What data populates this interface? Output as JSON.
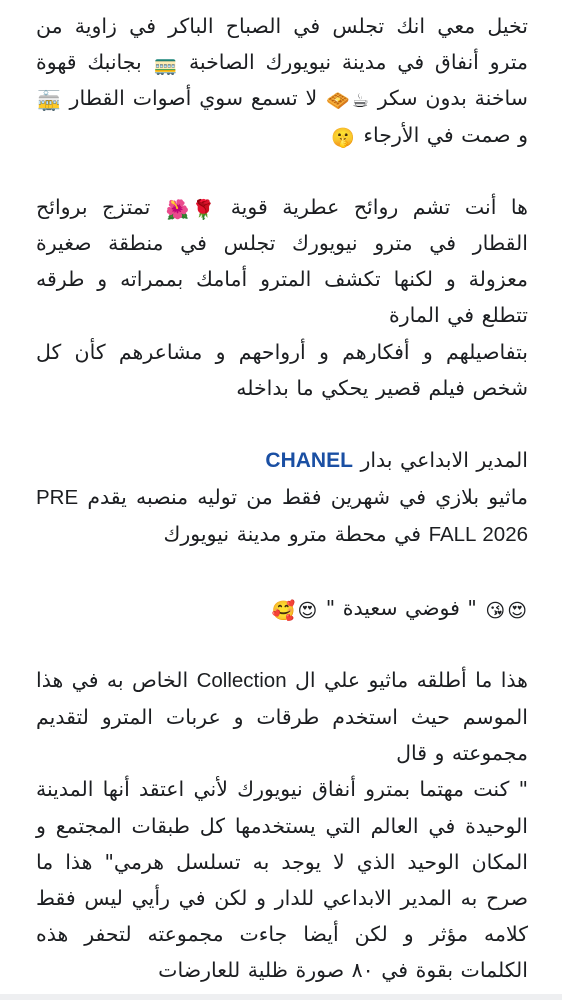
{
  "post": {
    "p1": {
      "a": "تخيل معي انك تجلس في الصباح الباكر في زاوية من مترو أنفاق في مدينة نيويورك الصاخبة",
      "train_emoji": "🚃",
      "b": "بجانبك قهوة ساخنة بدون سكر",
      "coffee_emoji": "☕",
      "waffle_emoji": "🧇",
      "c": "لا تسمع سوي أصوات القطار",
      "tram_emoji": "🚋",
      "d": "و صمت في الأرجاء",
      "shush_emoji": "🤫"
    },
    "p2": {
      "a": "ها أنت تشم روائح عطرية قوية",
      "rose_emoji": "🌹",
      "hibiscus_emoji": "🌺",
      "b": "تمتزج بروائح القطار في مترو نيويورك تجلس في منطقة صغيرة معزولة و لكنها تكشف المترو أمامك بممراته و طرقه تتطلع في المارة",
      "c": "بتفاصيلهم و أفكارهم و أرواحهم و مشاعرهم كأن كل شخص فيلم قصير يحكي ما بداخله"
    },
    "p3": {
      "a": "المدير الابداعي بدار",
      "brand": "CHANEL",
      "b": "ماثيو بلازي في شهرين فقط من توليه منصبه يقدم",
      "collection": "PRE FALL 2026",
      "c": "في محطة مترو مدينة نيويورك"
    },
    "p4": {
      "heart_eyes_emoji": "😍",
      "kiss_emoji": "😘",
      "text": "\" فوضي سعيدة \"",
      "heart_eyes_emoji_2": "😍",
      "hearts_face_emoji": "🥰"
    },
    "p5": {
      "a": "هذا ما أطلقه ماثيو علي ال",
      "collection_word": "Collection",
      "b": "الخاص به في هذا الموسم حيث استخدم طرقات و عربات المترو لتقديم مجموعته و قال",
      "quote": "\" كنت مهتما بمترو أنفاق نيويورك لأني اعتقد أنها المدينة الوحيدة في العالم التي يستخدمها كل طبقات المجتمع و المكان الوحيد الذي لا يوجد به تسلسل هرمي\"",
      "c": "هذا ما صرح به المدير الابداعي للدار و لكن في رأيي ليس فقط كلامه مؤثر و لكن أيضا جاءت مجموعته لتحفر هذه الكلمات بقوة في ٨٠ صورة ظلية للعارضات"
    }
  }
}
